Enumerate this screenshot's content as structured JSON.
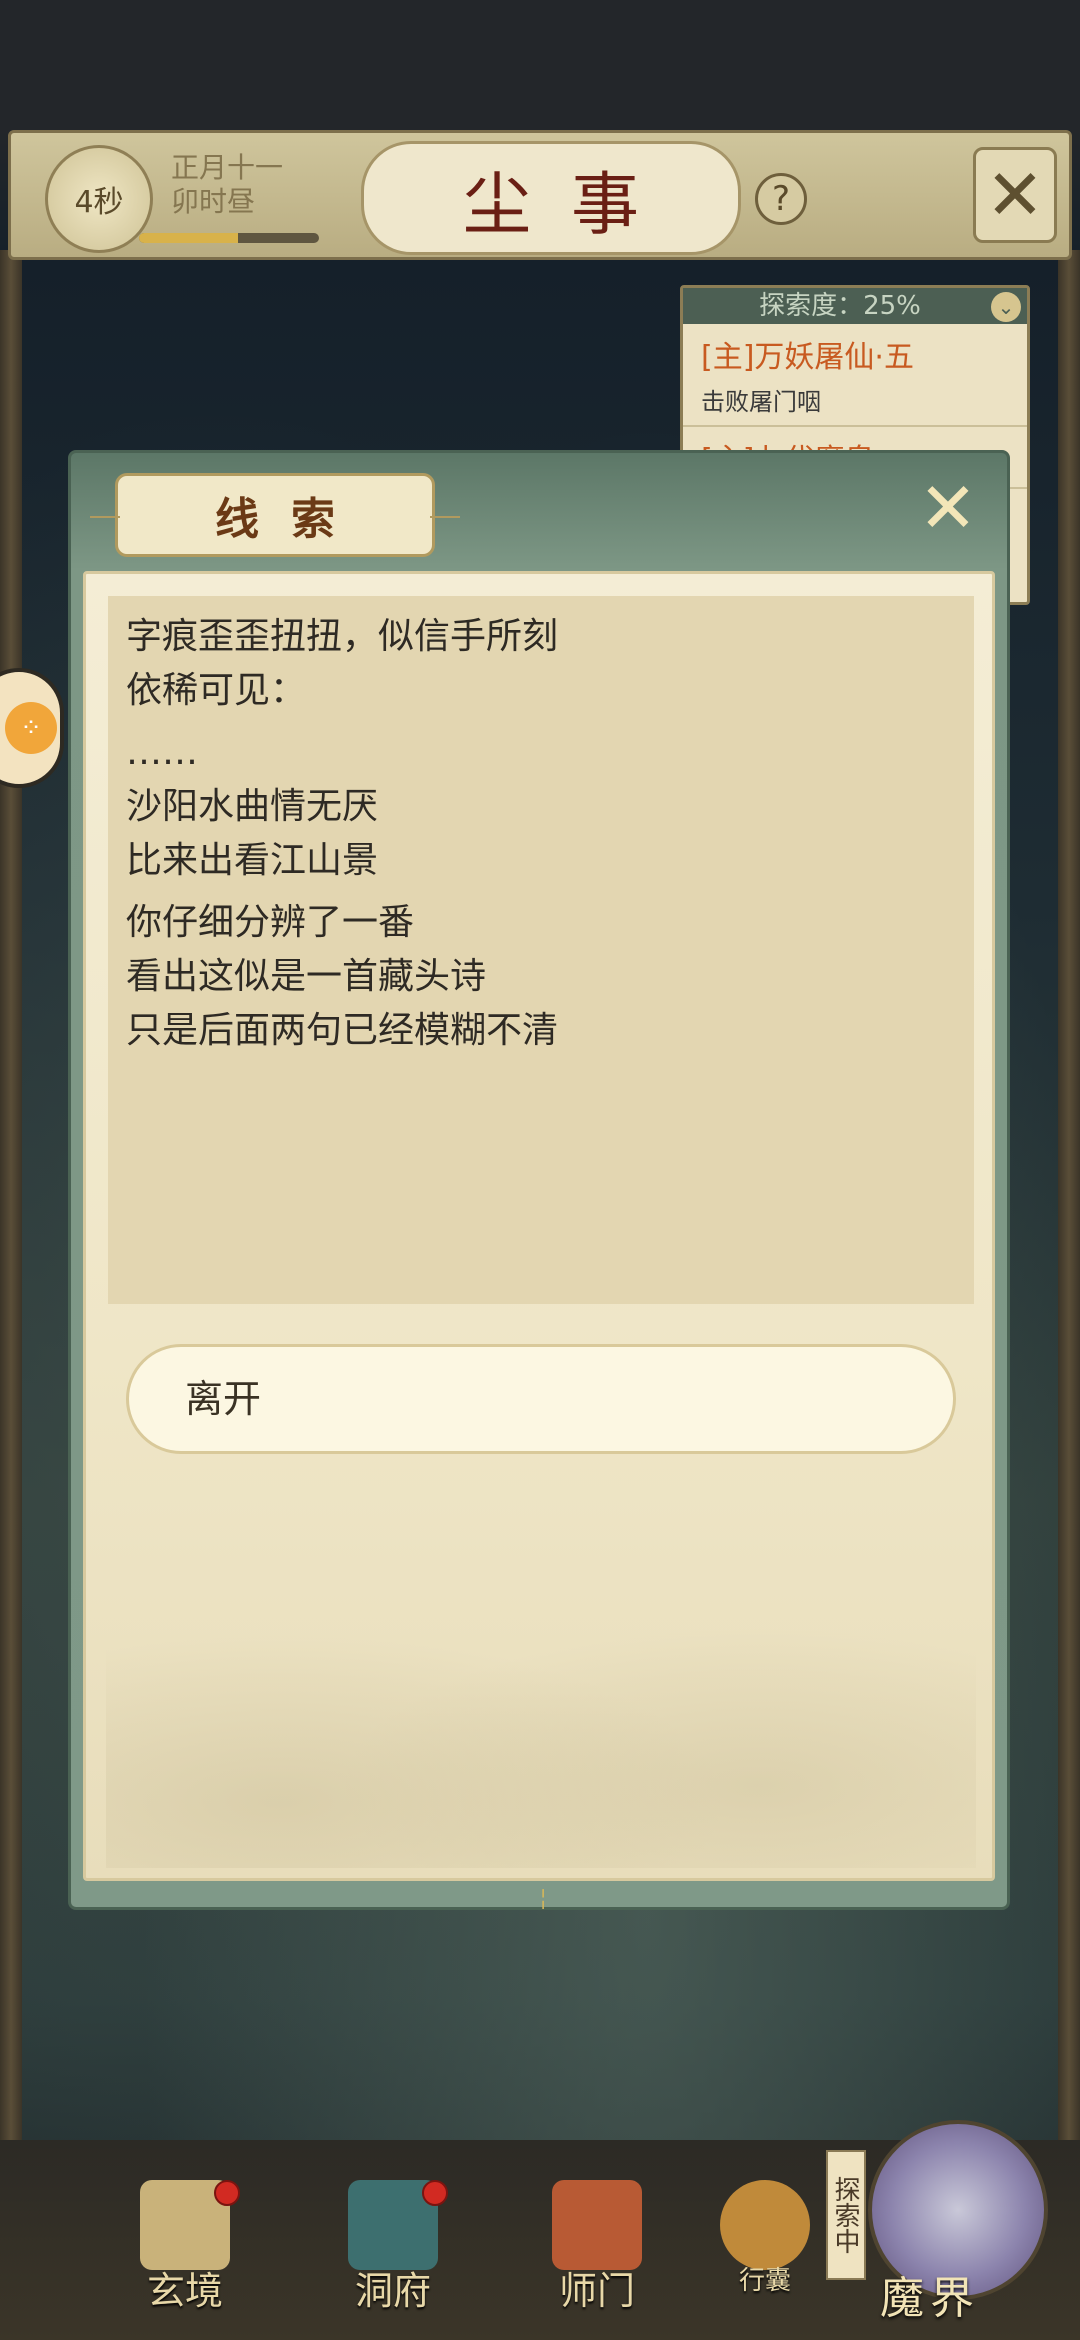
{
  "header": {
    "timer": "4秒",
    "date": "正月十一",
    "time_of_day": "卯时昼",
    "title": "尘事",
    "help_icon": "?",
    "menu_icon": "crossed-swords-icon",
    "time_progress": 0.55
  },
  "quest_panel": {
    "exploration_label": "探索度：25%",
    "items": [
      {
        "title": "[主]万妖屠仙·五",
        "subtitle": "击败屠门咽"
      },
      {
        "title": "[主]七代魔皇",
        "subtitle": ""
      }
    ]
  },
  "dialog": {
    "title": "线索",
    "close_icon": "crossed-swords-icon",
    "lines_block1": [
      "字痕歪歪扭扭，似信手所刻",
      "依稀可见："
    ],
    "ellipsis": "……",
    "lines_block2": [
      "沙阳水曲情无厌",
      "比来出看江山景"
    ],
    "lines_block3": [
      "你仔细分辨了一番",
      "看出这似是一首藏头诗",
      "只是后面两句已经模糊不清"
    ],
    "leave_button": "离开"
  },
  "bottom_nav": {
    "items": [
      {
        "label": "玄境",
        "badge": true
      },
      {
        "label": "洞府",
        "badge": true
      },
      {
        "label": "师门",
        "badge": false
      },
      {
        "label": "行囊",
        "badge": false
      }
    ],
    "explore_badge": "探索中",
    "demon_realm": "魔界"
  }
}
